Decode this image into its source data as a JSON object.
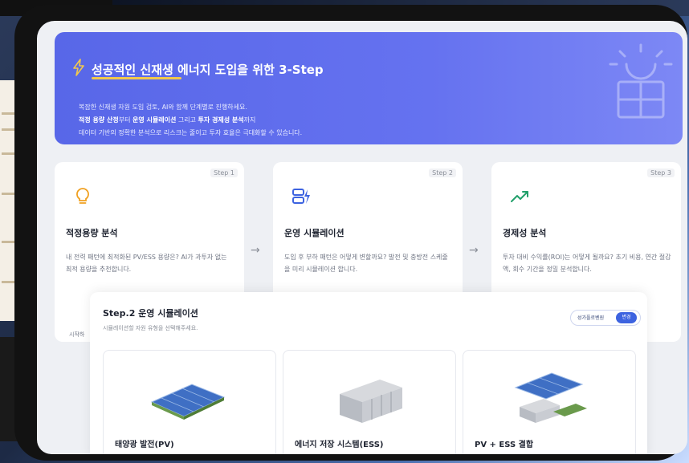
{
  "banner": {
    "title": "성공적인 신재생 에너지 도입을 위한 3-Step",
    "line1": "복잡한 신재생 자원 도입 검토, AI와 함께 단계별로 진행하세요.",
    "line2_b1": "적정 용량 산정",
    "line2_t1": "부터 ",
    "line2_b2": "운영 시뮬레이션",
    "line2_t2": " 그리고 ",
    "line2_b3": "투자 경제성 분석",
    "line2_t3": "까지",
    "line3": "데이터 기반의 정확한 분석으로 리스크는 줄이고 투자 효율은 극대화할 수 있습니다."
  },
  "steps": [
    {
      "tag": "Step 1",
      "title": "적정용량 분석",
      "desc": "내 전력 패턴에 최적화된 PV/ESS 용량은? AI가 과투자 없는 최적 용량을 추천합니다.",
      "icon": "lightbulb-icon",
      "color": "#f0a020"
    },
    {
      "tag": "Step 2",
      "title": "운영 시뮬레이션",
      "desc": "도입 후 부하 패턴은 어떻게 변할까요? 발전 및 충방전 스케줄을 미리 시뮬레이션 합니다.",
      "icon": "battery-server-icon",
      "color": "#3d63e0"
    },
    {
      "tag": "Step 3",
      "title": "경제성 분석",
      "desc": "투자 대비 수익률(ROI)는 어떻게 될까요? 초기 비용, 연간 절감액, 회수 기간을 정밀 분석합니다.",
      "icon": "trend-up-icon",
      "color": "#22a06b"
    }
  ],
  "cut_label": "시작하",
  "panel": {
    "title": "Step.2 운영 시뮬레이션",
    "subtitle": "시뮬레이션할 자원 유형을 선택해주세요.",
    "toggle_label": "성가플로벤원",
    "toggle_button": "변경",
    "options": [
      {
        "label": "태양광 발전(PV)",
        "icon": "solar-panel-icon"
      },
      {
        "label": "에너지 저장 시스템(ESS)",
        "icon": "ess-cabinet-icon"
      },
      {
        "label": "PV + ESS 결합",
        "icon": "pv-ess-combined-icon"
      }
    ]
  },
  "colors": {
    "accent": "#5867e8",
    "button": "#3d63e0",
    "underline": "#f2c94c"
  }
}
